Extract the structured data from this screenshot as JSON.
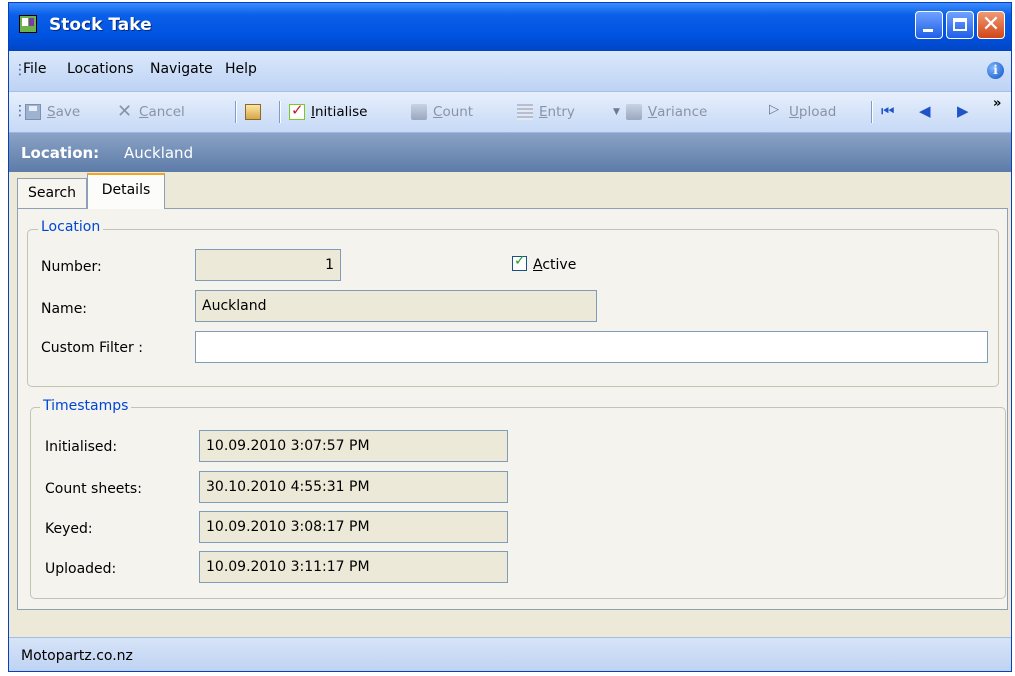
{
  "window": {
    "title": "Stock Take"
  },
  "menu": {
    "items": [
      "File",
      "Locations",
      "Navigate",
      "Help"
    ]
  },
  "toolbar": {
    "save": {
      "first": "S",
      "rest": "ave"
    },
    "cancel": {
      "first": "C",
      "rest": "ancel"
    },
    "initialise": {
      "first": "I",
      "rest": "nitialise"
    },
    "count": {
      "first": "C",
      "rest": "ount"
    },
    "entry": {
      "first": "E",
      "rest": "ntry"
    },
    "variance": {
      "first": "V",
      "rest": "ariance"
    },
    "upload": {
      "first": "U",
      "rest": "pload"
    },
    "overflow": "»"
  },
  "location_bar": {
    "label": "Location:",
    "value": "Auckland"
  },
  "tabs": [
    {
      "label": "Search"
    },
    {
      "label": "Details"
    }
  ],
  "location_group": {
    "title": "Location",
    "number_label": "Number:",
    "number_value": "1",
    "active_label_first": "A",
    "active_label_rest": "ctive",
    "active_checked": true,
    "name_label": "Name:",
    "name_value": "Auckland",
    "custom_filter_label": "Custom Filter :",
    "custom_filter_value": ""
  },
  "timestamps_group": {
    "title": "Timestamps",
    "initialised_label": "Initialised:",
    "initialised_value": "10.09.2010 3:07:57 PM",
    "count_sheets_label": "Count sheets:",
    "count_sheets_value": "30.10.2010 4:55:31 PM",
    "keyed_label": "Keyed:",
    "keyed_value": "10.09.2010 3:08:17 PM",
    "uploaded_label": "Uploaded:",
    "uploaded_value": "10.09.2010 3:11:17 PM"
  },
  "status": {
    "text": "Motopartz.co.nz"
  }
}
